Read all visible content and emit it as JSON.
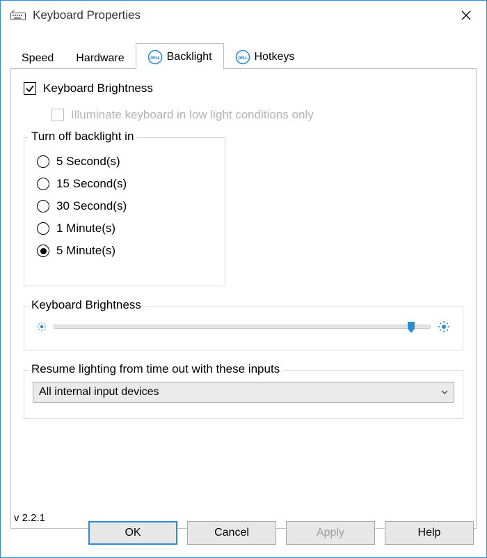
{
  "window": {
    "title": "Keyboard Properties"
  },
  "tabs": {
    "speed": "Speed",
    "hardware": "Hardware",
    "backlight": "Backlight",
    "hotkeys": "Hotkeys"
  },
  "checkbox_brightness_label": "Keyboard Brightness",
  "checkbox_lowlight_label": "Illuminate keyboard in low light conditions only",
  "turnoff": {
    "legend": "Turn off backlight in",
    "options": {
      "o0": "5 Second(s)",
      "o1": "15 Second(s)",
      "o2": "30 Second(s)",
      "o3": "1 Minute(s)",
      "o4": "5 Minute(s)"
    },
    "selected_index": 4
  },
  "brightness_slider": {
    "legend": "Keyboard Brightness",
    "value_percent": 95
  },
  "resume": {
    "legend": "Resume lighting from time out with these inputs",
    "selected": "All internal input devices"
  },
  "version_label": "v 2.2.1",
  "buttons": {
    "ok": "OK",
    "cancel": "Cancel",
    "apply": "Apply",
    "help": "Help"
  }
}
